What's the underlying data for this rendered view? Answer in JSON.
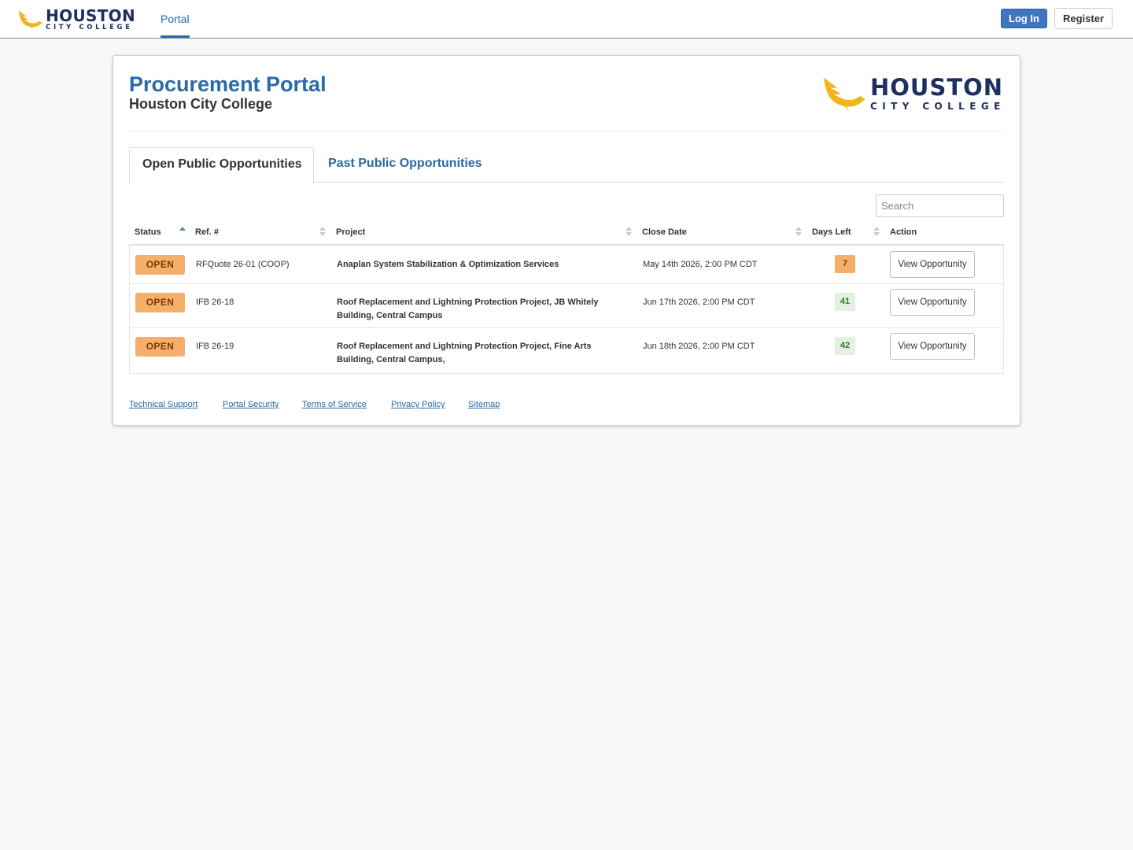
{
  "brand": {
    "line1": "HOUSTON",
    "line2": "CITY COLLEGE"
  },
  "nav": {
    "portal_label": "Portal",
    "login_label": "Log In",
    "register_label": "Register"
  },
  "header": {
    "title": "Procurement Portal",
    "subtitle": "Houston City College"
  },
  "tabs": [
    {
      "label": "Open Public Opportunities",
      "active": true
    },
    {
      "label": "Past Public Opportunities",
      "active": false
    }
  ],
  "search": {
    "placeholder": "Search",
    "value": ""
  },
  "table": {
    "columns": [
      "Status",
      "Ref. #",
      "Project",
      "Close Date",
      "Days Left",
      "Action"
    ],
    "sorted_column": "Status",
    "rows": [
      {
        "status": "OPEN",
        "ref": "RFQuote 26-01 (COOP)",
        "project": "Anaplan System Stabilization & Optimization Services",
        "close_date": "May 14th 2026, 2:00 PM CDT",
        "days_left": "7",
        "action": "View Opportunity"
      },
      {
        "status": "OPEN",
        "ref": "IFB 26-18",
        "project": "Roof Replacement and Lightning Protection Project, JB Whitely Building, Central Campus",
        "close_date": "Jun 17th 2026, 2:00 PM CDT",
        "days_left": "41",
        "action": "View Opportunity"
      },
      {
        "status": "OPEN",
        "ref": "IFB 26-19",
        "project": "Roof Replacement and Lightning Protection Project, Fine Arts Building, Central Campus,",
        "close_date": "Jun 18th 2026, 2:00 PM CDT",
        "days_left": "42",
        "action": "View Opportunity"
      }
    ]
  },
  "footer": {
    "links": [
      "Technical Support",
      "Portal Security",
      "Terms of Service",
      "Privacy Policy",
      "Sitemap"
    ]
  },
  "colors": {
    "accent": "#2a6aa6",
    "brand_navy": "#1d2f5e",
    "brand_gold": "#f2b31b",
    "status_open": "#f6ae6b",
    "days_ok": "#e3f1e0"
  },
  "icons": {
    "logo": "hawk-logo-icon",
    "sort": "sort-icon",
    "sort_asc": "sort-asc-icon"
  }
}
